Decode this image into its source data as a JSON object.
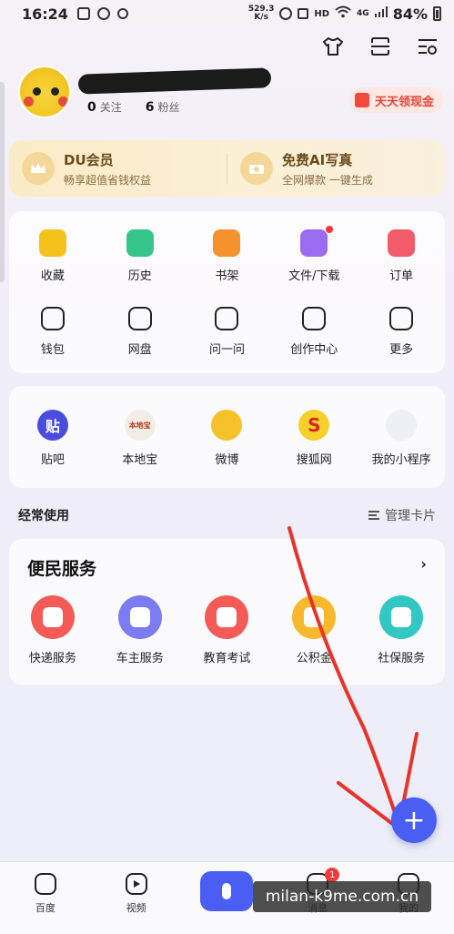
{
  "status_bar": {
    "time": "16:24",
    "net_speed_value": "529.3",
    "net_speed_unit": "K/s",
    "hd": "HD",
    "network": "4G",
    "battery": "84%"
  },
  "profile": {
    "follow_count": "0",
    "follow_label": "关注",
    "fans_count": "6",
    "fans_label": "粉丝",
    "cash_button": "天天领现金"
  },
  "vip": {
    "left_title": "DU会员",
    "left_sub": "畅享超值省钱权益",
    "right_title": "免费AI写真",
    "right_sub": "全网爆款  一键生成"
  },
  "tools": [
    {
      "label": "收藏",
      "icon": "star-icon",
      "color": "#f5c21b"
    },
    {
      "label": "历史",
      "icon": "clock-icon",
      "color": "#35c58a"
    },
    {
      "label": "书架",
      "icon": "bookshelf-icon",
      "color": "#f5922e"
    },
    {
      "label": "文件/下载",
      "icon": "download-icon",
      "color": "#9b6cf0"
    },
    {
      "label": "订单",
      "icon": "order-icon",
      "color": "#f25c6a"
    },
    {
      "label": "钱包",
      "icon": "wallet-icon",
      "color": "#222222"
    },
    {
      "label": "网盘",
      "icon": "cloud-icon",
      "color": "#222222"
    },
    {
      "label": "问一问",
      "icon": "question-icon",
      "color": "#222222"
    },
    {
      "label": "创作中心",
      "icon": "create-icon",
      "color": "#222222"
    },
    {
      "label": "更多",
      "icon": "more-icon",
      "color": "#222222"
    }
  ],
  "apps": [
    {
      "label": "贴吧",
      "icon": "tieba-icon",
      "color": "#4a4ce0",
      "glyph": "贴"
    },
    {
      "label": "本地宝",
      "icon": "bendibao-icon",
      "color": "#f4ede4",
      "glyph": "本地宝"
    },
    {
      "label": "微博",
      "icon": "weibo-icon",
      "color": "#f6c22a"
    },
    {
      "label": "搜狐网",
      "icon": "sohu-icon",
      "color": "#f5d12c",
      "glyph": "S"
    },
    {
      "label": "我的小程序",
      "icon": "miniapp-icon",
      "color": "#eef0f6"
    }
  ],
  "frequent": {
    "label": "经常使用",
    "manage": "管理卡片"
  },
  "services": {
    "title": "便民服务",
    "more": "›",
    "items": [
      {
        "label": "快递服务",
        "icon": "express-icon",
        "color": "#f45a56"
      },
      {
        "label": "车主服务",
        "icon": "car-icon",
        "color": "#7b7cf2"
      },
      {
        "label": "教育考试",
        "icon": "education-icon",
        "color": "#f45a56"
      },
      {
        "label": "公积金",
        "icon": "fund-icon",
        "color": "#f7b82b"
      },
      {
        "label": "社保服务",
        "icon": "social-security-icon",
        "color": "#33c7c4"
      }
    ]
  },
  "fab": "+",
  "bottom_nav": [
    {
      "label": "百度",
      "icon": "baidu-icon"
    },
    {
      "label": "视频",
      "icon": "video-icon"
    },
    {
      "label": "",
      "icon": "mic-icon"
    },
    {
      "label": "消息",
      "icon": "message-icon",
      "badge": "1"
    },
    {
      "label": "我的",
      "icon": "me-icon"
    }
  ],
  "watermark": "milan-k9me.com.cn"
}
